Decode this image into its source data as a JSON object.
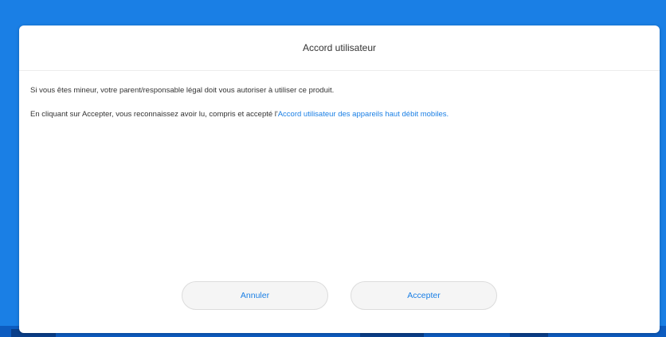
{
  "dialog": {
    "title": "Accord utilisateur",
    "paragraph1": "Si vous êtes mineur, votre parent/responsable légal doit vous autoriser à utiliser ce produit.",
    "paragraph2_prefix": "En cliquant sur Accepter, vous reconnaissez avoir lu, compris et accepté l'",
    "paragraph2_link": "Accord utilisateur des appareils haut débit mobiles.",
    "cancel_label": "Annuler",
    "accept_label": "Accepter"
  },
  "colors": {
    "background_blue": "#1a7fe5",
    "link_blue": "#1a7fe5",
    "dialog_bg": "#ffffff",
    "button_bg": "#f5f5f5"
  }
}
